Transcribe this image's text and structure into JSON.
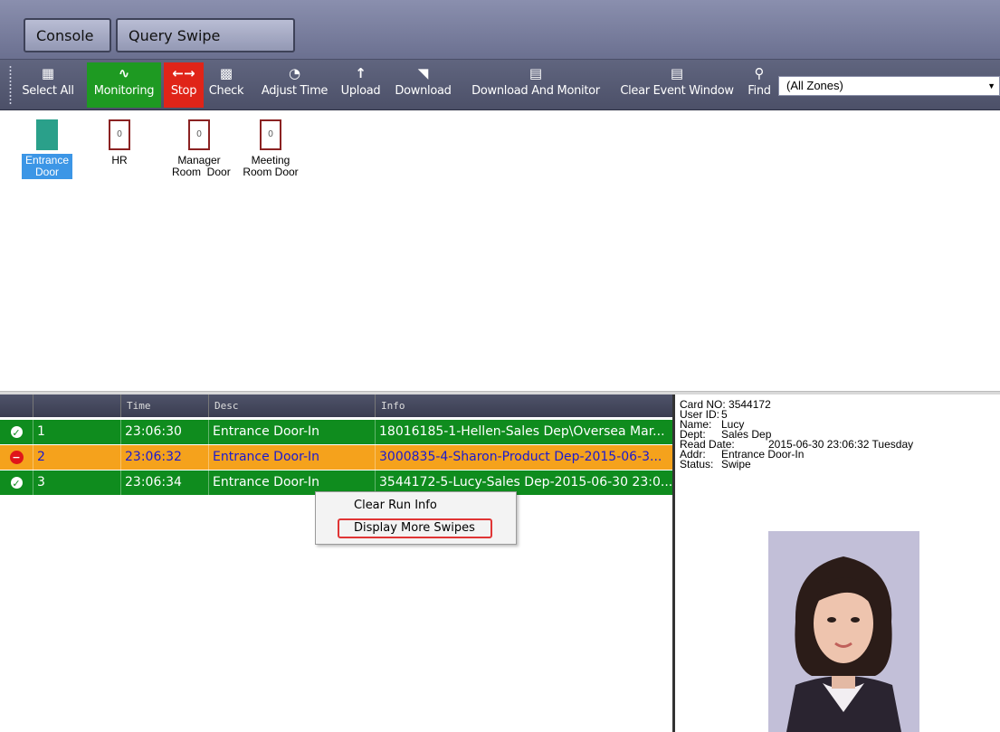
{
  "tabs": {
    "console": "Console",
    "query": "Query Swipe Records"
  },
  "toolbar": {
    "select_all": "Select All",
    "monitoring": "Monitoring",
    "stop": "Stop",
    "check": "Check",
    "adjust_time": "Adjust Time",
    "upload": "Upload",
    "download": "Download",
    "download_monitor": "Download And Monitor",
    "clear_event": "Clear Event Window",
    "find": "Find",
    "zone_value": "(All Zones)"
  },
  "doors": [
    {
      "line1": "Entrance",
      "line2": "Door",
      "count": "",
      "selected": true
    },
    {
      "line1": "HR",
      "line2": "",
      "count": "0",
      "selected": false
    },
    {
      "line1": "Manager",
      "line2": "Room  Door",
      "count": "0",
      "selected": false
    },
    {
      "line1": "Meeting",
      "line2": "Room Door",
      "count": "0",
      "selected": false
    }
  ],
  "grid": {
    "headers": {
      "time": "Time",
      "desc": "Desc",
      "info": "Info"
    },
    "rows": [
      {
        "no": "1",
        "time": "23:06:30",
        "desc": "Entrance Door-In",
        "info": "18016185-1-Hellen-Sales Dep\\Oversea Mar...",
        "status": "ok"
      },
      {
        "no": "2",
        "time": "23:06:32",
        "desc": "Entrance Door-In",
        "info": "3000835-4-Sharon-Product Dep-2015-06-3...",
        "status": "warn"
      },
      {
        "no": "3",
        "time": "23:06:34",
        "desc": "Entrance Door-In",
        "info": "3544172-5-Lucy-Sales Dep-2015-06-30 23:0...",
        "status": "ok"
      }
    ]
  },
  "context_menu": {
    "clear_run_info": "Clear Run Info",
    "display_more": "Display More Swipes"
  },
  "detail": {
    "card_no_label": "Card NO:",
    "card_no": "3544172",
    "user_id_label": "User ID:",
    "user_id": "5",
    "name_label": "Name:",
    "name": "Lucy",
    "dept_label": "Dept:",
    "dept": "Sales Dep",
    "read_date_label": "Read Date:",
    "read_date": "2015-06-30 23:06:32 Tuesday",
    "addr_label": "Addr:",
    "addr": "Entrance Door-In",
    "status_label": "Status:",
    "status": "Swipe"
  },
  "colors": {
    "ok_row": "#0f8c1e",
    "warn_row": "#f5a21c",
    "monitoring": "#1e9a22",
    "stop": "#e02418",
    "selected_door": "#3c96e6"
  }
}
